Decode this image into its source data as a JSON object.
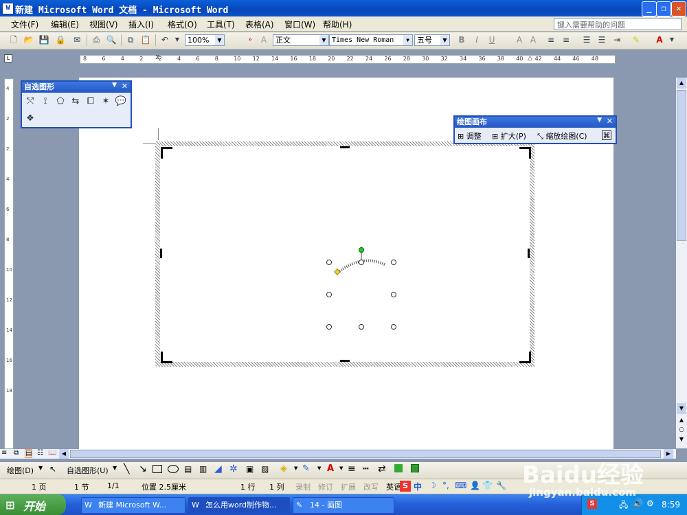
{
  "window": {
    "title": "新建 Microsoft Word 文档 - Microsoft Word",
    "buttons": {
      "minimize": "_",
      "maximize": "❐",
      "close": "✕"
    }
  },
  "menu": {
    "items": [
      "文件(F)",
      "编辑(E)",
      "视图(V)",
      "插入(I)",
      "格式(O)",
      "工具(T)",
      "表格(A)",
      "窗口(W)",
      "帮助(H)"
    ],
    "help_placeholder": "键入需要帮助的问题"
  },
  "toolbar": {
    "zoom": "100%",
    "style": "正文",
    "font": "Times New Roman",
    "size": "五号",
    "bold": "B",
    "italic": "I",
    "underline": "U",
    "aa_glyph": "A"
  },
  "ruler": {
    "numbers": [
      "8",
      "6",
      "4",
      "2",
      "2",
      "4",
      "6",
      "8",
      "10",
      "12",
      "14",
      "16",
      "18",
      "20",
      "22",
      "24",
      "26",
      "28",
      "30",
      "32",
      "34",
      "36",
      "38",
      "40",
      "42",
      "44",
      "46",
      "48"
    ],
    "vnumbers": [
      "4",
      "2",
      "2",
      "4",
      "6",
      "8",
      "10",
      "12",
      "14",
      "16",
      "18"
    ]
  },
  "autoshapes_toolbar": {
    "title": "自选图形"
  },
  "canvas_toolbar": {
    "title": "绘图画布",
    "fit": "调整",
    "expand": "扩大(P)",
    "scale": "缩放绘图(C)"
  },
  "drawing_toolbar": {
    "draw": "绘图(D)",
    "autoshapes": "自选图形(U)"
  },
  "status": {
    "page": "1 页",
    "section": "1 节",
    "pages": "1/1",
    "position": "位置 2.5厘米",
    "line": "1 行",
    "column": "1 列",
    "rec": "录制",
    "trk": "修订",
    "ext": "扩展",
    "ovr": "改写",
    "lang": "英语"
  },
  "taskbar": {
    "start": "开始",
    "tasks": [
      "新建 Microsoft W...",
      "怎么用word制作物...",
      "14 - 画图"
    ],
    "clock": "8:59"
  },
  "watermark": {
    "brand": "Baidu经验",
    "url": "jingyan.baidu.com"
  }
}
